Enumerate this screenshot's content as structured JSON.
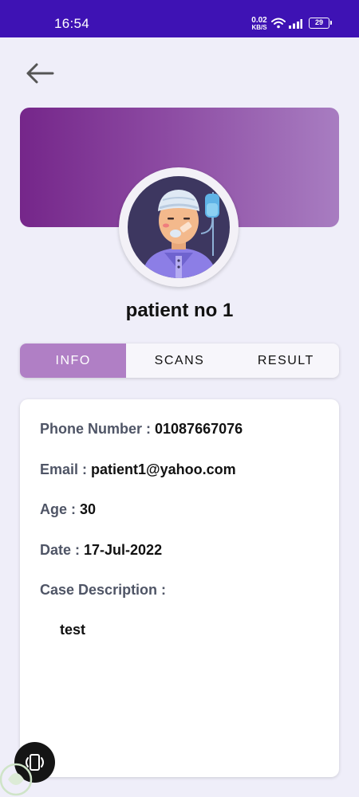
{
  "status_bar": {
    "time": "16:54",
    "net_speed_value": "0.02",
    "net_speed_unit": "KB/S",
    "battery": "29"
  },
  "header": {
    "back_icon": "arrow-left-icon"
  },
  "profile": {
    "name": "patient no 1",
    "avatar_icon": "patient-avatar-icon"
  },
  "tabs": [
    {
      "label": "INFO",
      "active": true
    },
    {
      "label": "SCANS",
      "active": false
    },
    {
      "label": "RESULT",
      "active": false
    }
  ],
  "info": {
    "phone_label": "Phone Number : ",
    "phone_value": "01087667076",
    "email_label": "Email : ",
    "email_value": "patient1@yahoo.com",
    "age_label": "Age : ",
    "age_value": "30",
    "date_label": "Date : ",
    "date_value": "17-Jul-2022",
    "case_label": "Case Description :",
    "case_value": "test"
  },
  "colors": {
    "status_bar": "#3e12b4",
    "accent": "#b07fc5",
    "banner_start": "#75268a",
    "banner_end": "#a87dc1",
    "background": "#efeef9"
  }
}
